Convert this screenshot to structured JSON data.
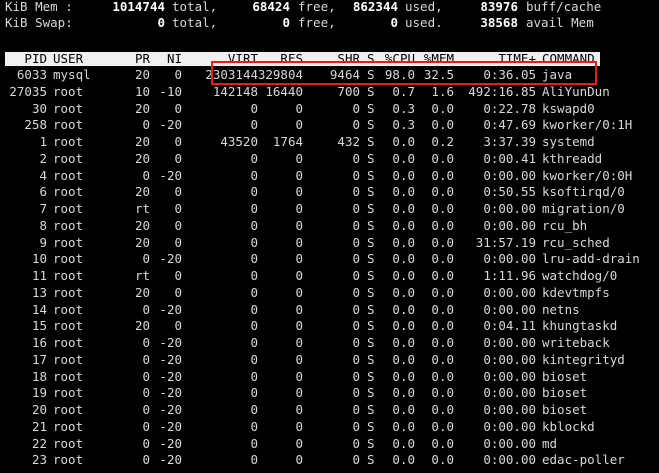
{
  "summary": {
    "mem": {
      "label": "KiB Mem :",
      "total": "1014744",
      "total_label": "total,",
      "free": "68424",
      "free_label": "free,",
      "used": "862344",
      "used_label": "used,",
      "buff": "83976",
      "buff_label": "buff/cache"
    },
    "swap": {
      "label": "KiB Swap:",
      "total": "0",
      "total_label": "total,",
      "free": "0",
      "free_label": "free,",
      "used": "0",
      "used_label": "used.",
      "avail": "38568",
      "avail_label": "avail Mem"
    }
  },
  "table": {
    "columns": [
      "PID",
      "USER",
      "PR",
      "NI",
      "VIRT",
      "RES",
      "SHR",
      "S",
      "%CPU",
      "%MEM",
      "TIME+",
      "COMMAND"
    ],
    "rows": [
      [
        "6033",
        "mysql",
        "20",
        "0",
        "2303144",
        "329804",
        "9464",
        "S",
        "98.0",
        "32.5",
        "0:36.05",
        "java"
      ],
      [
        "27035",
        "root",
        "10",
        "-10",
        "142148",
        "16440",
        "700",
        "S",
        "0.7",
        "1.6",
        "492:16.85",
        "AliYunDun"
      ],
      [
        "30",
        "root",
        "20",
        "0",
        "0",
        "0",
        "0",
        "S",
        "0.3",
        "0.0",
        "0:22.78",
        "kswapd0"
      ],
      [
        "258",
        "root",
        "0",
        "-20",
        "0",
        "0",
        "0",
        "S",
        "0.3",
        "0.0",
        "0:47.69",
        "kworker/0:1H"
      ],
      [
        "1",
        "root",
        "20",
        "0",
        "43520",
        "1764",
        "432",
        "S",
        "0.0",
        "0.2",
        "3:37.39",
        "systemd"
      ],
      [
        "2",
        "root",
        "20",
        "0",
        "0",
        "0",
        "0",
        "S",
        "0.0",
        "0.0",
        "0:00.41",
        "kthreadd"
      ],
      [
        "4",
        "root",
        "0",
        "-20",
        "0",
        "0",
        "0",
        "S",
        "0.0",
        "0.0",
        "0:00.00",
        "kworker/0:0H"
      ],
      [
        "6",
        "root",
        "20",
        "0",
        "0",
        "0",
        "0",
        "S",
        "0.0",
        "0.0",
        "0:50.55",
        "ksoftirqd/0"
      ],
      [
        "7",
        "root",
        "rt",
        "0",
        "0",
        "0",
        "0",
        "S",
        "0.0",
        "0.0",
        "0:00.00",
        "migration/0"
      ],
      [
        "8",
        "root",
        "20",
        "0",
        "0",
        "0",
        "0",
        "S",
        "0.0",
        "0.0",
        "0:00.00",
        "rcu_bh"
      ],
      [
        "9",
        "root",
        "20",
        "0",
        "0",
        "0",
        "0",
        "S",
        "0.0",
        "0.0",
        "31:57.19",
        "rcu_sched"
      ],
      [
        "10",
        "root",
        "0",
        "-20",
        "0",
        "0",
        "0",
        "S",
        "0.0",
        "0.0",
        "0:00.00",
        "lru-add-drain"
      ],
      [
        "11",
        "root",
        "rt",
        "0",
        "0",
        "0",
        "0",
        "S",
        "0.0",
        "0.0",
        "1:11.96",
        "watchdog/0"
      ],
      [
        "13",
        "root",
        "20",
        "0",
        "0",
        "0",
        "0",
        "S",
        "0.0",
        "0.0",
        "0:00.00",
        "kdevtmpfs"
      ],
      [
        "14",
        "root",
        "0",
        "-20",
        "0",
        "0",
        "0",
        "S",
        "0.0",
        "0.0",
        "0:00.00",
        "netns"
      ],
      [
        "15",
        "root",
        "20",
        "0",
        "0",
        "0",
        "0",
        "S",
        "0.0",
        "0.0",
        "0:04.11",
        "khungtaskd"
      ],
      [
        "16",
        "root",
        "0",
        "-20",
        "0",
        "0",
        "0",
        "S",
        "0.0",
        "0.0",
        "0:00.00",
        "writeback"
      ],
      [
        "17",
        "root",
        "0",
        "-20",
        "0",
        "0",
        "0",
        "S",
        "0.0",
        "0.0",
        "0:00.00",
        "kintegrityd"
      ],
      [
        "18",
        "root",
        "0",
        "-20",
        "0",
        "0",
        "0",
        "S",
        "0.0",
        "0.0",
        "0:00.00",
        "bioset"
      ],
      [
        "19",
        "root",
        "0",
        "-20",
        "0",
        "0",
        "0",
        "S",
        "0.0",
        "0.0",
        "0:00.00",
        "bioset"
      ],
      [
        "20",
        "root",
        "0",
        "-20",
        "0",
        "0",
        "0",
        "S",
        "0.0",
        "0.0",
        "0:00.00",
        "bioset"
      ],
      [
        "21",
        "root",
        "0",
        "-20",
        "0",
        "0",
        "0",
        "S",
        "0.0",
        "0.0",
        "0:00.00",
        "kblockd"
      ],
      [
        "22",
        "root",
        "0",
        "-20",
        "0",
        "0",
        "0",
        "S",
        "0.0",
        "0.0",
        "0:00.00",
        "md"
      ],
      [
        "23",
        "root",
        "0",
        "-20",
        "0",
        "0",
        "0",
        "S",
        "0.0",
        "0.0",
        "0:00.00",
        "edac-poller"
      ]
    ]
  },
  "colors": {
    "background": "#000000",
    "text": "#d8d8d8",
    "header_bar": "#f0f0f0",
    "highlight": "#e02020"
  }
}
